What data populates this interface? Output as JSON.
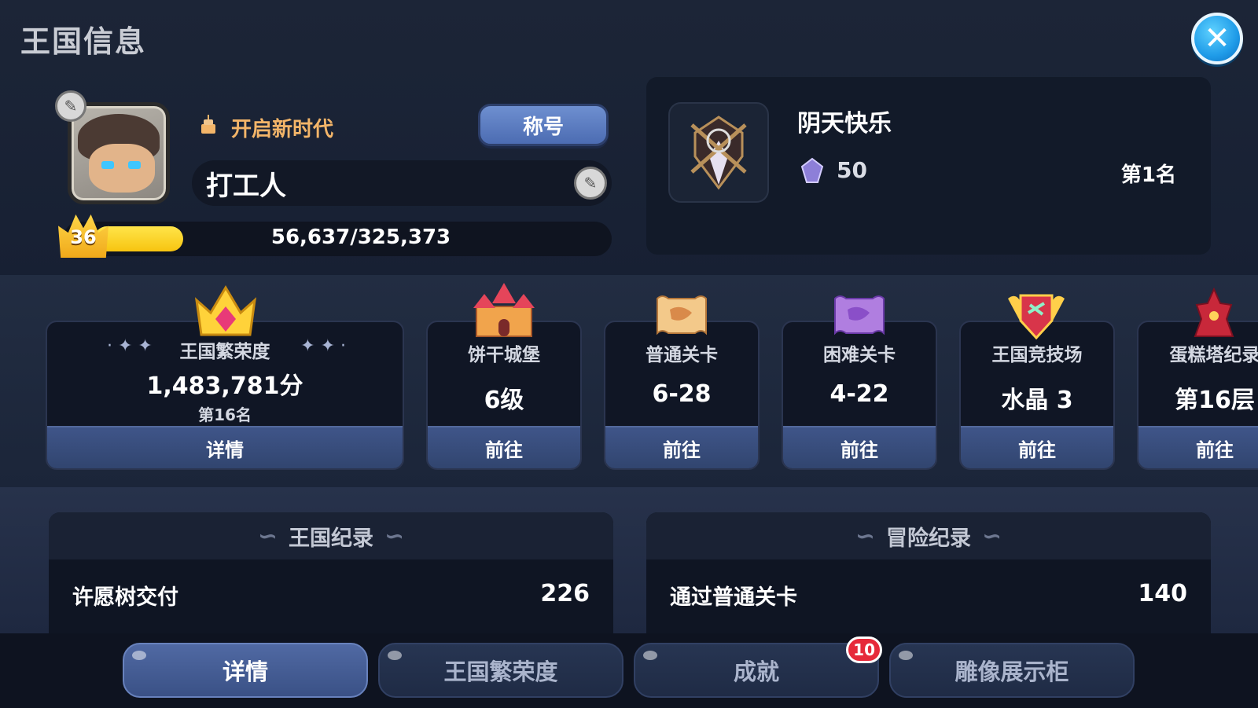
{
  "header": {
    "title": "王国信息",
    "close_icon": "close-icon"
  },
  "profile": {
    "era_label": "开启新时代",
    "title_button": "称号",
    "name": "打工人",
    "level": "36",
    "xp_text": "56,637/325,373",
    "xp_fraction": 0.174
  },
  "guild": {
    "name": "阴天快乐",
    "score": "50",
    "rank": "第1名"
  },
  "cards": [
    {
      "label": "王国繁荣度",
      "value": "1,483,781分",
      "rank": "第16名",
      "button": "详情"
    },
    {
      "label": "饼干城堡",
      "value": "6级",
      "button": "前往"
    },
    {
      "label": "普通关卡",
      "value": "6-28",
      "button": "前往"
    },
    {
      "label": "困难关卡",
      "value": "4-22",
      "button": "前往"
    },
    {
      "label": "王国竞技场",
      "value": "水晶 3",
      "button": "前往"
    },
    {
      "label": "蛋糕塔纪录",
      "value": "第16层",
      "button": "前往"
    }
  ],
  "kingdom_record": {
    "title": "王国纪录",
    "rows": [
      {
        "label": "许愿树交付",
        "value": "226"
      }
    ]
  },
  "adventure_record": {
    "title": "冒险纪录",
    "rows": [
      {
        "label": "通过普通关卡",
        "value": "140"
      }
    ]
  },
  "tabs": [
    {
      "label": "详情",
      "active": true
    },
    {
      "label": "王国繁荣度"
    },
    {
      "label": "成就",
      "badge": "10"
    },
    {
      "label": "雕像展示柜"
    }
  ],
  "colors": {
    "accent_blue": "#4c6cb2",
    "xp_yellow": "#f7c410",
    "era_orange": "#f3b569",
    "badge_red": "#e6293a"
  }
}
